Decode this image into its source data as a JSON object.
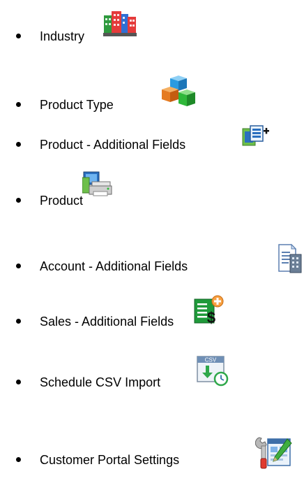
{
  "list": {
    "items": [
      {
        "label": "Industry",
        "icon": "buildings-icon"
      },
      {
        "label": "Product Type",
        "icon": "cubes-icon"
      },
      {
        "label": "Product - Additional Fields",
        "icon": "product-add-fields-icon"
      },
      {
        "label": "Product",
        "icon": "computer-printer-icon"
      },
      {
        "label": "Account - Additional Fields",
        "icon": "document-building-icon"
      },
      {
        "label": "Sales - Additional Fields",
        "icon": "sales-dollar-add-icon"
      },
      {
        "label": "Schedule CSV Import",
        "icon": "csv-schedule-icon"
      },
      {
        "label": "Customer Portal Settings",
        "icon": "portal-settings-icon"
      }
    ]
  },
  "colors": {
    "text": "#000000",
    "background": "#ffffff"
  }
}
